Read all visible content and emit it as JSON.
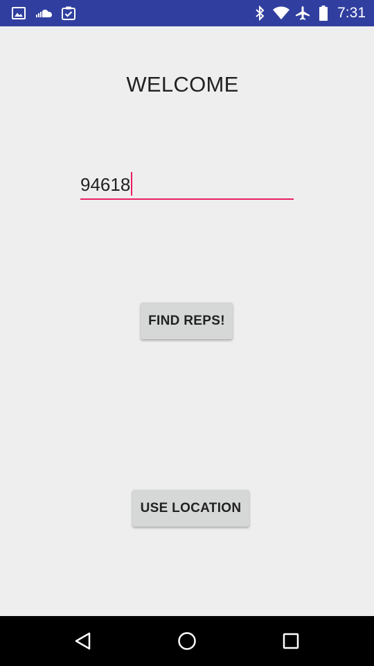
{
  "status_bar": {
    "time": "7:31",
    "left_icons": [
      "image-icon",
      "cloud-icon",
      "clipboard-check-icon"
    ],
    "right_icons": [
      "bluetooth-icon",
      "wifi-icon",
      "airplane-icon",
      "battery-icon"
    ],
    "color": "#303f9f"
  },
  "main": {
    "title": "WELCOME",
    "zip_input": {
      "value": "94618",
      "accent_color": "#e91e63"
    },
    "find_button_label": "FIND REPS!",
    "location_button_label": "USE LOCATION"
  },
  "nav_bar": {
    "buttons": [
      "back-icon",
      "home-icon",
      "recents-icon"
    ]
  }
}
